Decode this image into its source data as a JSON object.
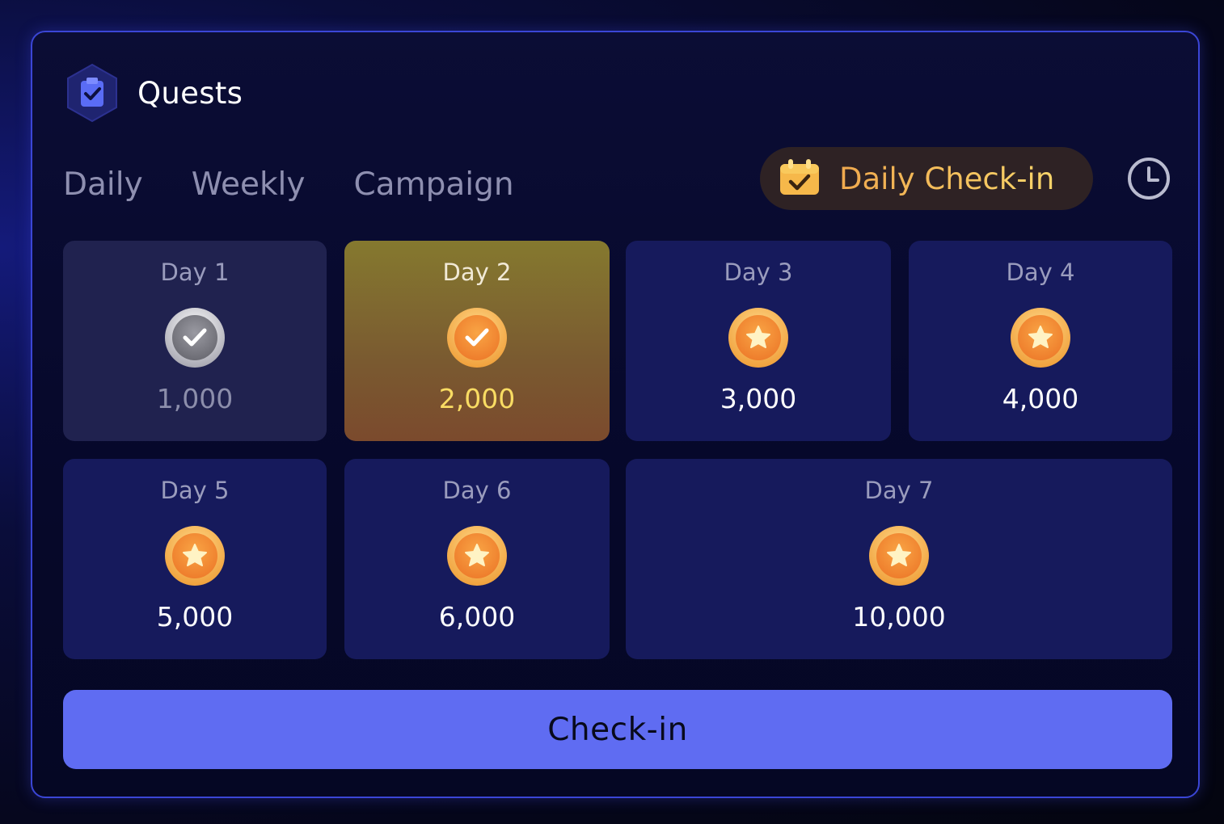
{
  "header": {
    "title": "Quests",
    "icon": "clipboard-check-icon"
  },
  "tabs": [
    {
      "label": "Daily"
    },
    {
      "label": "Weekly"
    },
    {
      "label": "Campaign"
    }
  ],
  "daily_checkin": {
    "label": "Daily Check-in",
    "icon": "calendar-check-icon"
  },
  "history_icon": "clock-icon",
  "days": [
    {
      "label": "Day 1",
      "amount": "1,000",
      "status": "claimed",
      "icon": "silver-check-coin-icon"
    },
    {
      "label": "Day 2",
      "amount": "2,000",
      "status": "today",
      "icon": "gold-check-coin-icon"
    },
    {
      "label": "Day 3",
      "amount": "3,000",
      "status": "upcoming",
      "icon": "star-coin-icon"
    },
    {
      "label": "Day 4",
      "amount": "4,000",
      "status": "upcoming",
      "icon": "star-coin-icon"
    },
    {
      "label": "Day 5",
      "amount": "5,000",
      "status": "upcoming",
      "icon": "star-coin-icon"
    },
    {
      "label": "Day 6",
      "amount": "6,000",
      "status": "upcoming",
      "icon": "star-coin-icon"
    },
    {
      "label": "Day 7",
      "amount": "10,000",
      "status": "upcoming",
      "icon": "star-coin-icon"
    }
  ],
  "action": {
    "label": "Check-in"
  },
  "colors": {
    "accent": "#5f6cf2",
    "border": "#3b46d6",
    "gold": "#f9dc63",
    "pill_text": "#f2b45a"
  }
}
